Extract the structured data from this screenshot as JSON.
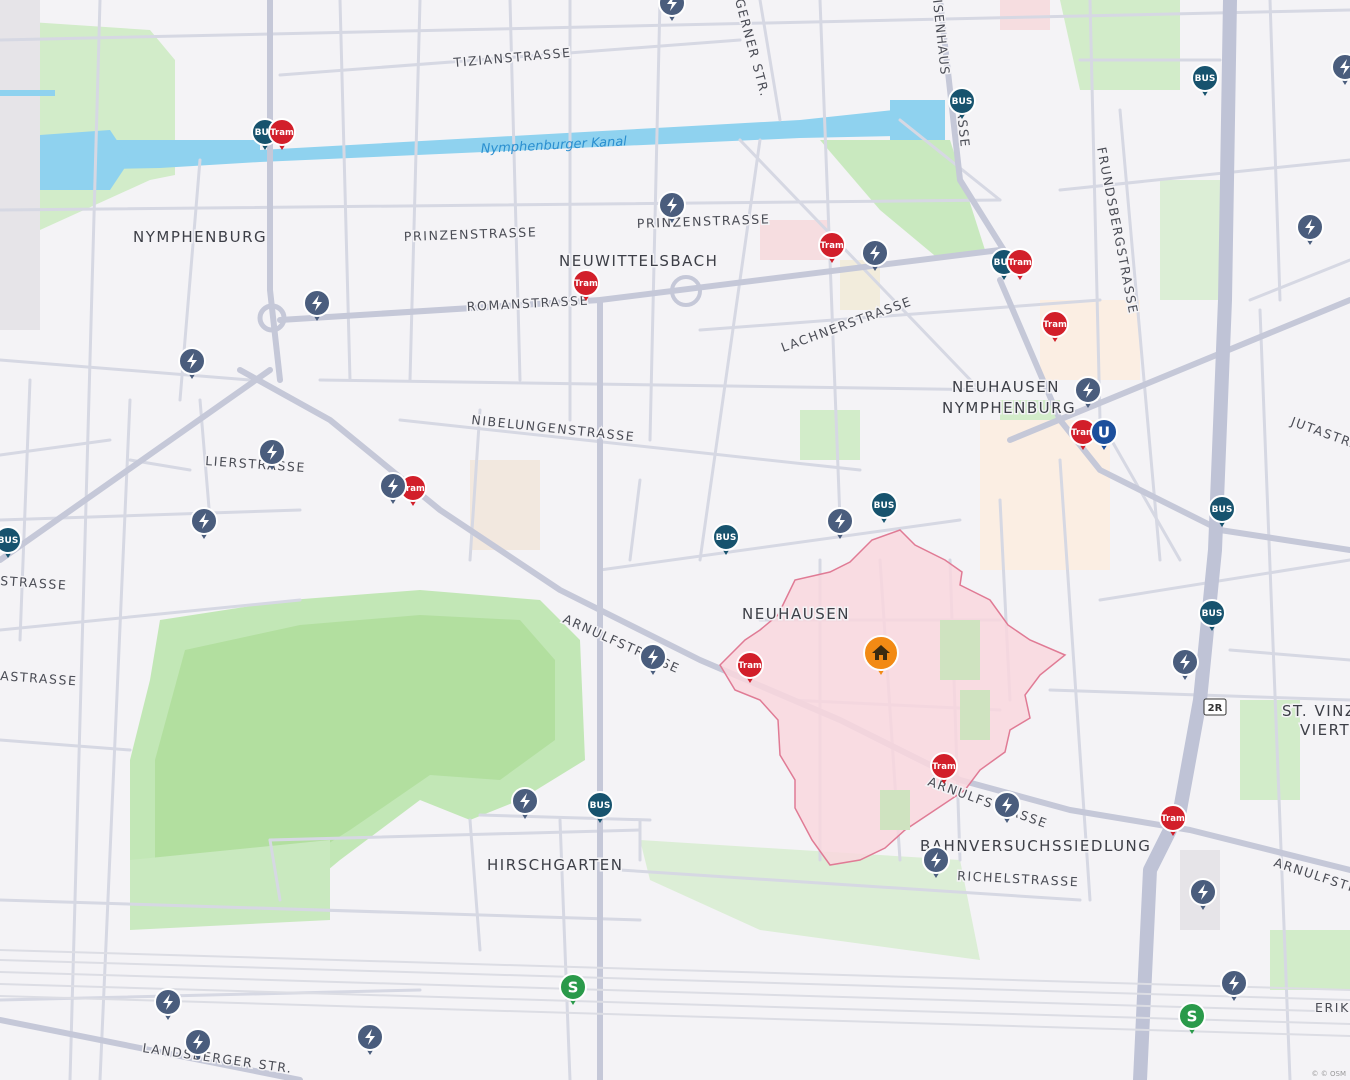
{
  "colors": {
    "background": "#f4f3f6",
    "road": "#d6d8e3",
    "road_major": "#c5c8d8",
    "park": "#d2ecc9",
    "park_dark": "#b8e3ab",
    "water": "#8fd2ef",
    "area_pink": "#f9d7de",
    "area_outline": "#e07b95",
    "bus": "#17536e",
    "tram": "#d21f2a",
    "charging": "#4a5d7d",
    "home": "#f28a14",
    "sbahn": "#2a9a4a",
    "ubahn": "#1c4f9c"
  },
  "place_labels": [
    {
      "text": "NYMPHENBURG"
    },
    {
      "text": "NEUWITTELSBACH"
    },
    {
      "text": "NEUHAUSEN"
    },
    {
      "text": "NYMPHENBURG"
    },
    {
      "text": "NEUHAUSEN"
    },
    {
      "text": "HIRSCHGARTEN"
    },
    {
      "text": "ST. VINZE"
    },
    {
      "text": "VIERTE"
    },
    {
      "text": "BAHNVERSUCHSSIEDLUNG"
    }
  ],
  "street_labels": [
    {
      "text": "TIZIANSTRASSE"
    },
    {
      "text": "PRINZENSTRASSE"
    },
    {
      "text": "PRINZENSTRASSE"
    },
    {
      "text": "ROMANSTRASSE"
    },
    {
      "text": "LACHNERSTRASSE"
    },
    {
      "text": "NIBELUNGENSTRASSE"
    },
    {
      "text": "LIERSTRASSE"
    },
    {
      "text": "ARNULFSTRASSE"
    },
    {
      "text": "ARNULFSTRASSE"
    },
    {
      "text": "RICHELSTRASSE"
    },
    {
      "text": "LANDSBERGER STR."
    },
    {
      "text": "FRUNDSBERGSTRASSE"
    },
    {
      "text": "GERNER STR."
    },
    {
      "text": "STRASSE"
    },
    {
      "text": "ASTRASSE"
    },
    {
      "text": "JUTASTRA"
    },
    {
      "text": "ARNULFSTR"
    },
    {
      "text": "ERIK"
    },
    {
      "text": "ISENHAUS"
    },
    {
      "text": "ASSE"
    }
  ],
  "water_labels": [
    {
      "text": "Nymphenburger Kanal"
    }
  ],
  "road_shields": [
    {
      "text": "2R"
    }
  ],
  "pin_labels": {
    "bus": "BUS",
    "tram": "Tram",
    "sbahn": "S",
    "ubahn": "U",
    "charging_icon": "lightning-bolt-icon",
    "home_icon": "house-icon"
  },
  "pins": [
    {
      "type": "bus"
    },
    {
      "type": "bus"
    },
    {
      "type": "bus"
    },
    {
      "type": "bus"
    },
    {
      "type": "bus"
    },
    {
      "type": "bus"
    },
    {
      "type": "bus"
    },
    {
      "type": "bus"
    },
    {
      "type": "bus"
    },
    {
      "type": "bus"
    },
    {
      "type": "tram"
    },
    {
      "type": "tram"
    },
    {
      "type": "tram"
    },
    {
      "type": "tram"
    },
    {
      "type": "tram"
    },
    {
      "type": "tram"
    },
    {
      "type": "tram"
    },
    {
      "type": "tram"
    },
    {
      "type": "tram"
    },
    {
      "type": "tram"
    },
    {
      "type": "charging"
    },
    {
      "type": "charging"
    },
    {
      "type": "charging"
    },
    {
      "type": "charging"
    },
    {
      "type": "charging"
    },
    {
      "type": "charging"
    },
    {
      "type": "charging"
    },
    {
      "type": "charging"
    },
    {
      "type": "charging"
    },
    {
      "type": "charging"
    },
    {
      "type": "charging"
    },
    {
      "type": "charging"
    },
    {
      "type": "charging"
    },
    {
      "type": "charging"
    },
    {
      "type": "charging"
    },
    {
      "type": "charging"
    },
    {
      "type": "charging"
    },
    {
      "type": "charging"
    },
    {
      "type": "charging"
    },
    {
      "type": "charging"
    },
    {
      "type": "charging"
    },
    {
      "type": "charging"
    },
    {
      "type": "sbahn"
    },
    {
      "type": "sbahn"
    },
    {
      "type": "ubahn"
    },
    {
      "type": "home"
    }
  ],
  "attribution": "© © OSM"
}
